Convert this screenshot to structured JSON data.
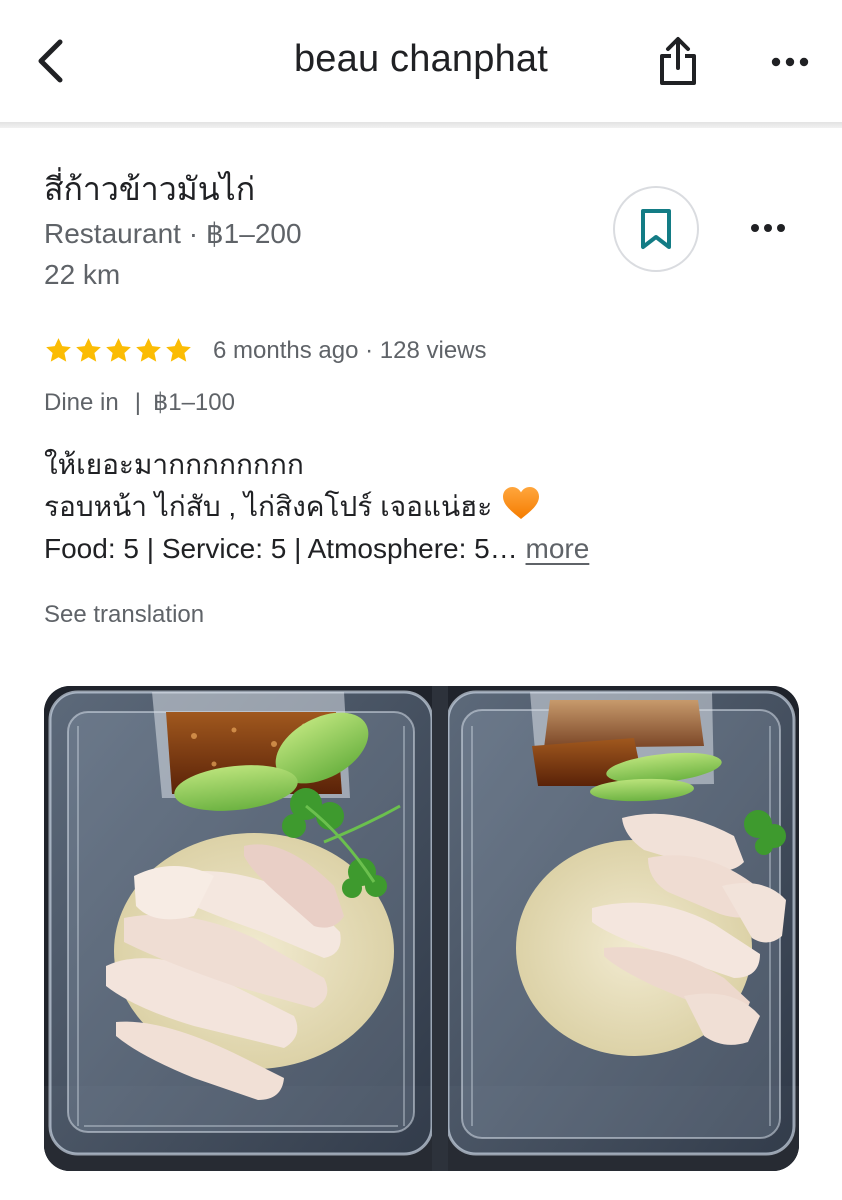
{
  "header": {
    "title": "beau chanphat",
    "back_icon": "chevron-left-icon",
    "share_icon": "share-icon",
    "more_icon": "more-horizontal-icon"
  },
  "place": {
    "name": "สี่ก้าวข้าวมันไก่",
    "category": "Restaurant",
    "price_range": "฿1–200",
    "distance": "22 km",
    "save_icon": "bookmark-icon",
    "accent_color": "#137c85"
  },
  "review": {
    "rating": 5,
    "rating_max": 5,
    "star_color": "#fbbc04",
    "time_ago": "6 months ago",
    "views": "128 views",
    "service_type": "Dine in",
    "price_paid": "฿1–100",
    "text_line1": "ให้เยอะมากกกกกกกก",
    "text_line2": "รอบหน้า ไก่สับ , ไก่สิงคโปร์ เจอแน่ฮะ",
    "emoji": "orange-heart",
    "food_label": "Food",
    "food_score": "5",
    "service_label": "Service",
    "service_score": "5",
    "atmosphere_label": "Atmosphere",
    "atmosphere_score": "5…",
    "more_label": "more",
    "see_translation": "See translation"
  },
  "photo": {
    "subject": "two plastic takeaway boxes of Hainanese chicken rice with sauce, cucumber and coriander"
  }
}
